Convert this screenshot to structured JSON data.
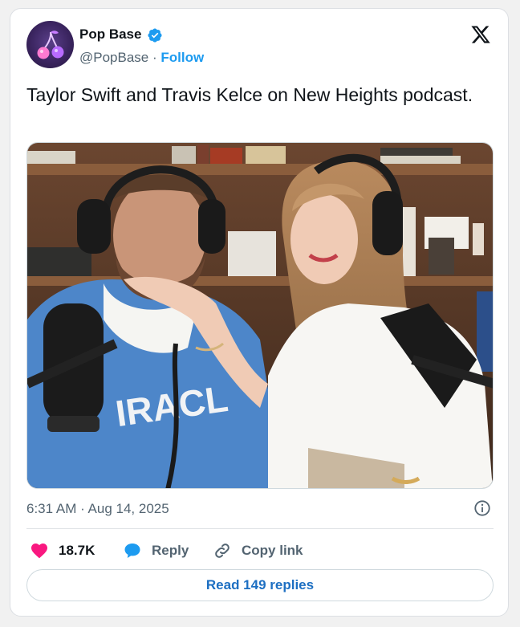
{
  "tweet": {
    "author": {
      "name": "Pop Base",
      "handle": "@PopBase",
      "separator": "·",
      "follow_label": "Follow",
      "verified": true,
      "avatar_icon": "cherry-avatar-icon"
    },
    "text": "Taylor Swift and Travis Kelce on New Heights podcast.",
    "timestamp": "6:31 AM · Aug 14, 2025",
    "actions": {
      "like_count": "18.7K",
      "reply_label": "Reply",
      "copy_link_label": "Copy link"
    },
    "read_replies_label": "Read 149 replies"
  },
  "colors": {
    "accent": "#1d9bf0",
    "like": "#f91880",
    "text": "#0f1419",
    "muted": "#536471"
  }
}
